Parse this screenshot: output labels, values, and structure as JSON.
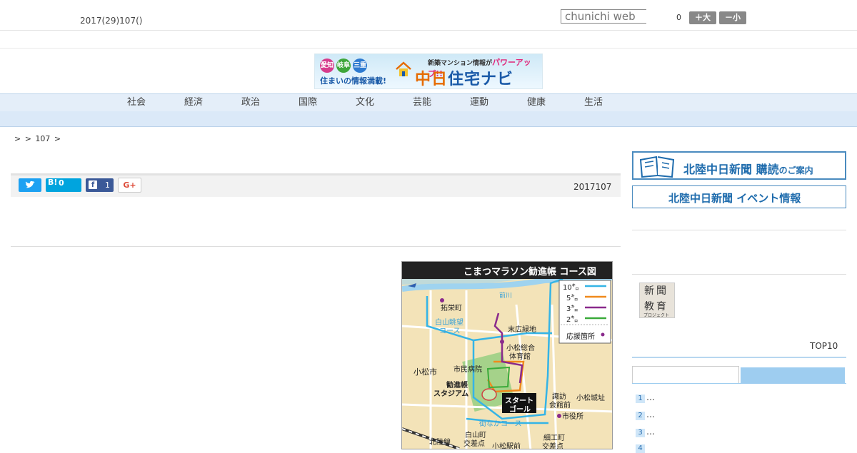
{
  "header": {
    "date": "2017(29)107()",
    "search_placeholder": "chunichi web",
    "counter": "0",
    "font_large": "＋大",
    "font_small": "－小"
  },
  "banner": {
    "pref1": "愛知",
    "pref2": "岐阜",
    "pref3": "三重",
    "tagline": "住まいの情報満載!",
    "top": "新築マンション情報が",
    "top_accent": "パワーアップ!!",
    "brand_a": "中日",
    "brand_b": "住宅ナビ"
  },
  "nav": {
    "items": [
      "社会",
      "経済",
      "政治",
      "国際",
      "文化",
      "芸能",
      "運動",
      "健康",
      "生活"
    ]
  },
  "breadcrumb": ">  > 107 >",
  "share": {
    "hatena_label": "B!",
    "hatena_count": "0",
    "facebook_count": "1",
    "gplus_label": "G+"
  },
  "article": {
    "date": "2017107"
  },
  "map": {
    "title": "こまつマラソン勧進帳 コース図",
    "legend": [
      {
        "label": "10㌔",
        "color": "#35b4e6"
      },
      {
        "label": "5㌔",
        "color": "#f08a1c"
      },
      {
        "label": "3㌔",
        "color": "#8a2a8c"
      },
      {
        "label": "2㌔",
        "color": "#3aaa3a"
      }
    ],
    "legend_support": "応援箇所",
    "labels": {
      "takuei": "拓栄町",
      "hakusan_a": "白山眺望",
      "hakusan_b": "コース",
      "maekawa": "前川",
      "suehiro": "末広緑地",
      "gym_a": "小松総合",
      "gym_b": "体育館",
      "city": "小松市",
      "hospital": "市民病院",
      "stadium_a": "勧進帳",
      "stadium_b": "スタジアム",
      "start": "スタート",
      "goal": "ゴール",
      "suwa_a": "諏訪",
      "suwa_b": "会館前",
      "castle": "小松城址",
      "cityhall": "市役所",
      "machinaka": "街なかコース",
      "hakusan_cho_a": "白山町",
      "hakusan_cho_b": "交差点",
      "saiku_a": "細工町",
      "saiku_b": "交差点",
      "station": "小松駅前",
      "hokuriku": "北陸線"
    }
  },
  "sidebar": {
    "ad1_main": "北陸中日新聞 購読",
    "ad1_tail": "のご案内",
    "ad2": "北陸中日新聞 イベント情報",
    "edu_a": "新聞",
    "edu_b": "教育",
    "edu_c": "プロジェクト",
    "top10": "TOP10",
    "ranks": [
      {
        "n": "1",
        "text": "…"
      },
      {
        "n": "2",
        "text": "…"
      },
      {
        "n": "3",
        "text": "…"
      },
      {
        "n": "4",
        "text": ""
      }
    ]
  }
}
